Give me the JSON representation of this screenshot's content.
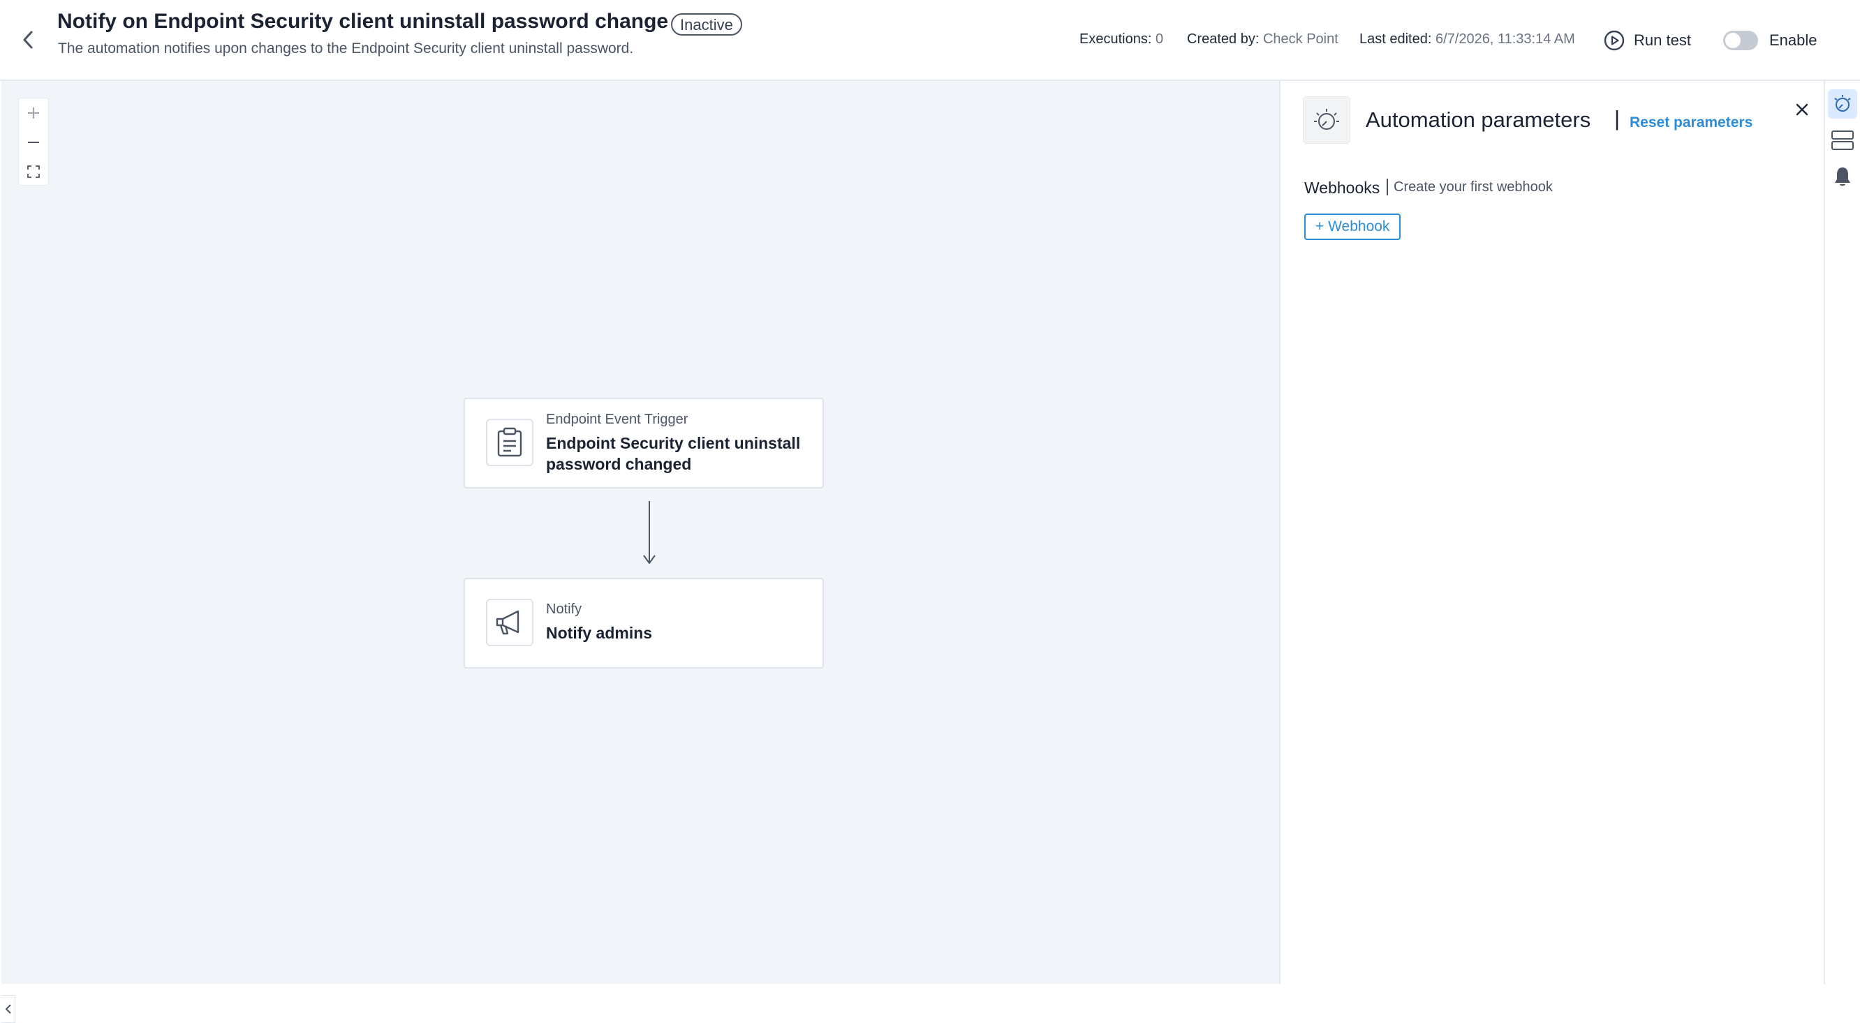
{
  "header": {
    "title": "Notify on Endpoint Security client uninstall password change",
    "status": "Inactive",
    "subtitle": "The automation notifies upon changes to the Endpoint Security client uninstall password.",
    "executions_label": "Executions:",
    "executions_value": "0",
    "created_by_label": "Created by:",
    "created_by_value": "Check Point",
    "last_edited_label": "Last edited:",
    "last_edited_value": "6/7/2026, 11:33:14 AM",
    "run_test_label": "Run test",
    "enable_label": "Enable",
    "enabled": false
  },
  "canvas": {
    "nodes": [
      {
        "type": "Endpoint Event Trigger",
        "name": "Endpoint Security client uninstall password changed",
        "icon": "clipboard-icon"
      },
      {
        "type": "Notify",
        "name": "Notify admins",
        "icon": "megaphone-icon"
      }
    ],
    "zoom_controls": [
      "zoom-in-icon",
      "zoom-out-icon",
      "fit-view-icon"
    ]
  },
  "panel": {
    "title": "Automation parameters",
    "reset_label": "Reset parameters",
    "webhooks_label": "Webhooks",
    "webhooks_hint": "Create your first webhook",
    "add_webhook_label": "+ Webhook"
  },
  "rail": {
    "items": [
      "automation-parameters-icon",
      "layout-icon",
      "bell-icon"
    ],
    "active": "automation-parameters-icon"
  },
  "colors": {
    "accent": "#2d8cd6",
    "canvas_bg": "#f1f4f9",
    "border": "#dfe3ea"
  }
}
